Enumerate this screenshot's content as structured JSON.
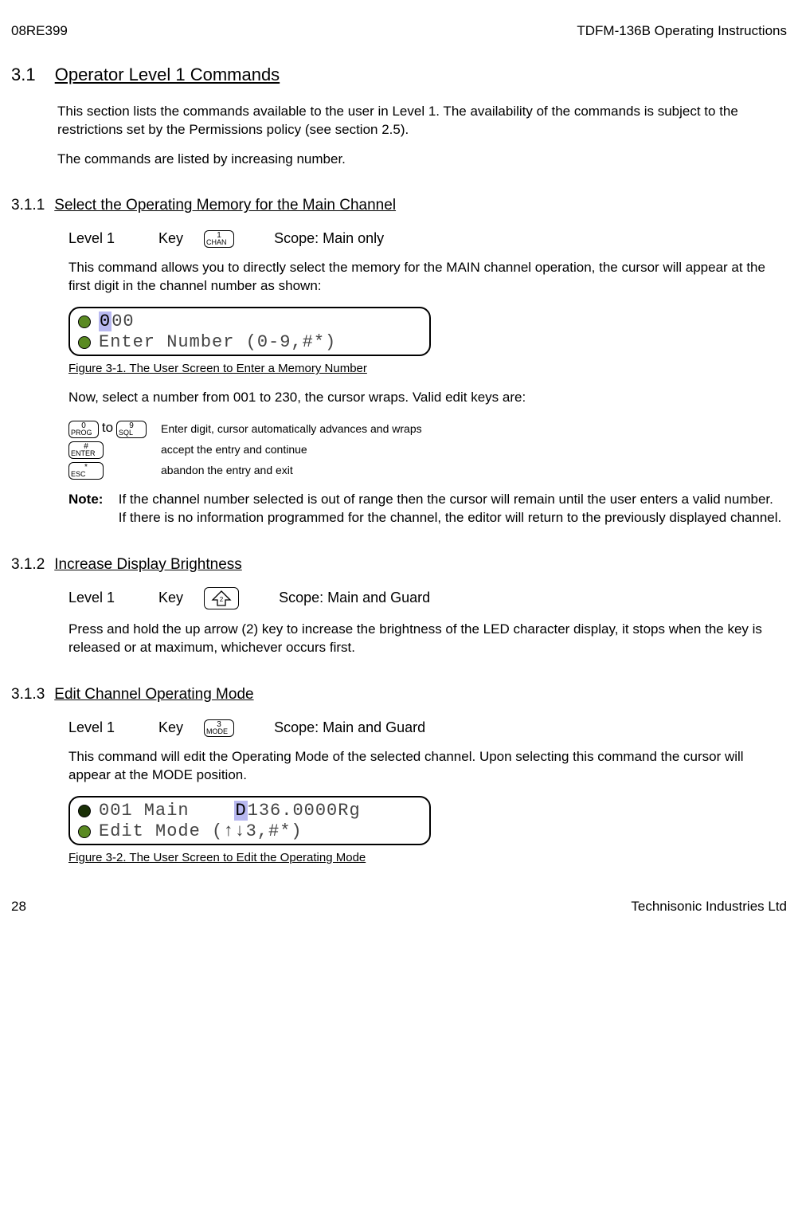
{
  "header": {
    "left": "08RE399",
    "right": "TDFM-136B Operating Instructions"
  },
  "footer": {
    "left": "28",
    "right": "Technisonic Industries Ltd"
  },
  "s31": {
    "num": "3.1",
    "title": "Operator Level 1 Commands",
    "p1": "This section lists the commands available to the user in Level 1.  The availability of the commands is subject to the restrictions set by the Permissions policy (see section 2.5).",
    "p2": "The commands are listed by increasing number."
  },
  "s311": {
    "num": "3.1.1",
    "title": "Select the Operating Memory for the Main Channel",
    "level": "Level 1",
    "keylabel": "Key",
    "key": {
      "top": "1",
      "bot": "CHAN"
    },
    "scope": "Scope: Main only",
    "p1": "This command allows you to directly select the memory for the MAIN channel operation, the cursor will appear at the first digit in the channel number as shown:",
    "lcd": {
      "l1_hl": "0",
      "l1_rest": "00",
      "l2": "Enter Number (0-9,#*)"
    },
    "figcap": "Figure 3-1. The User Screen to Enter a Memory Number",
    "p2": "Now, select a number from 001 to 230, the cursor wraps.  Valid edit keys are:",
    "keys": {
      "k0": {
        "top": "0",
        "bot": "PROG"
      },
      "to": "to",
      "k9": {
        "top": "9",
        "bot": "SQL"
      },
      "d09": "Enter digit, cursor automatically advances and wraps",
      "kEnter": {
        "top": "#",
        "bot": "ENTER"
      },
      "dEnter": "accept the entry and continue",
      "kEsc": {
        "top": "*",
        "bot": "ESC"
      },
      "dEsc": "abandon the entry and exit"
    },
    "note_label": "Note:",
    "note": "If the channel number selected is out of range then the cursor will remain until the user enters a valid number. If there is no information programmed for the channel, the editor will return to the previously displayed channel."
  },
  "s312": {
    "num": "3.1.2",
    "title": "Increase Display Brightness",
    "level": "Level 1",
    "keylabel": "Key",
    "scope": "Scope: Main and Guard",
    "p1": "Press and hold the up arrow (2) key to increase the brightness of the LED character display, it stops when the key is released or at maximum, whichever occurs first."
  },
  "s313": {
    "num": "3.1.3",
    "title": "Edit Channel Operating Mode",
    "level": "Level 1",
    "keylabel": "Key",
    "key": {
      "top": "3",
      "bot": "MODE"
    },
    "scope": "Scope: Main and Guard",
    "p1": "This command will edit the Operating Mode of the selected channel. Upon selecting this command the cursor will appear at the MODE position.",
    "lcd": {
      "l1a": "001 Main    ",
      "l1_hl": "D",
      "l1b": "136.0000Rg",
      "l2": "Edit Mode (↑↓3,#*)"
    },
    "figcap": "Figure 3-2. The User Screen to Edit the Operating Mode"
  }
}
